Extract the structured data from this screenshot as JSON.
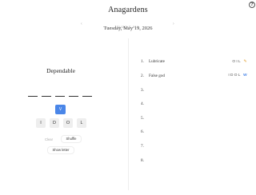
{
  "app": {
    "title": "Anagardens",
    "help_symbol": "?"
  },
  "date_nav": {
    "date": "Tuesday, May 19, 2026",
    "puzzle_label": "PUZZLE 819",
    "prev_symbol": "‹",
    "next_symbol": "›"
  },
  "current_clue": {
    "word": "Dependable",
    "pool_letter": "V",
    "letters": [
      "I",
      "D",
      "O",
      "L"
    ]
  },
  "controls": {
    "clear": "Clear",
    "shuffle": "Shuffle",
    "show_letter": "Show letter"
  },
  "words": [
    {
      "num": "1.",
      "clue": "Lubricate",
      "letters": "OIL",
      "icon": "pencil-icon",
      "highlight": ""
    },
    {
      "num": "2.",
      "clue": "False god",
      "letters": "IDOL",
      "icon": "",
      "highlight": "W"
    },
    {
      "num": "3.",
      "clue": "",
      "letters": "",
      "icon": "",
      "highlight": ""
    },
    {
      "num": "4.",
      "clue": "",
      "letters": "",
      "icon": "",
      "highlight": ""
    },
    {
      "num": "5.",
      "clue": "",
      "letters": "",
      "icon": "",
      "highlight": ""
    },
    {
      "num": "6.",
      "clue": "",
      "letters": "",
      "icon": "",
      "highlight": ""
    },
    {
      "num": "7.",
      "clue": "",
      "letters": "",
      "icon": "",
      "highlight": ""
    },
    {
      "num": "8.",
      "clue": "",
      "letters": "",
      "icon": "",
      "highlight": ""
    }
  ],
  "colors": {
    "accent": "#4a86e8",
    "tile": "#eeeeee",
    "pencil": "#e0a030"
  }
}
